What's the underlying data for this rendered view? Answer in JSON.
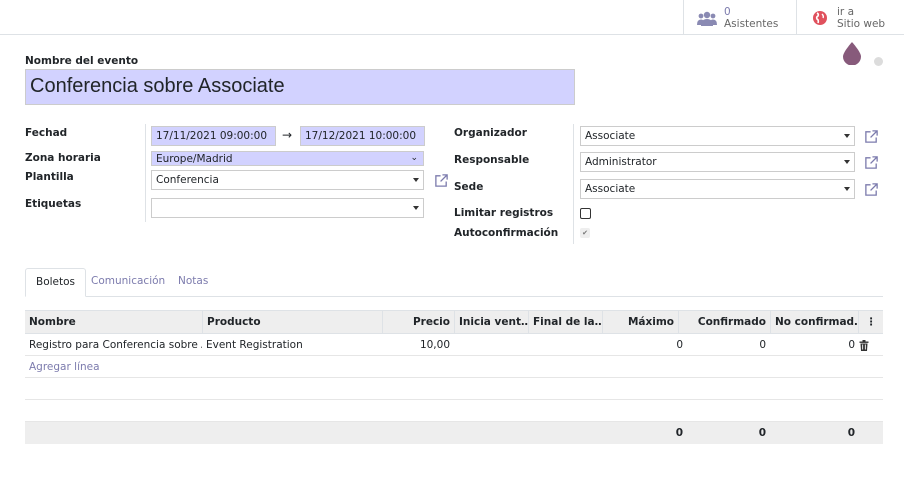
{
  "smart_buttons": {
    "attendees": {
      "count": "0",
      "label": "Asistentes"
    },
    "website": {
      "line1": "ir a",
      "line2": "Sitio web"
    }
  },
  "title_label": "Nombre del evento",
  "title_value": "Conferencia sobre Associate",
  "left_fields": {
    "date_label": "Fechad",
    "date_begin": "17/11/2021 09:00:00",
    "date_arrow": "→",
    "date_end": "17/12/2021 10:00:00",
    "tz_label": "Zona horaria",
    "tz_value": "Europe/Madrid",
    "template_label": "Plantilla",
    "template_value": "Conferencia",
    "tags_label": "Etiquetas",
    "tags_value": ""
  },
  "right_fields": {
    "organizer_label": "Organizador",
    "organizer_value": "Associate",
    "responsible_label": "Responsable",
    "responsible_value": "Administrator",
    "venue_label": "Sede",
    "venue_value": "Associate",
    "limit_label": "Limitar registros",
    "autoconfirm_label": "Autoconfirmación",
    "limit_checked": false,
    "autoconfirm_checked": true
  },
  "tabs": [
    {
      "label": "Boletos",
      "active": true
    },
    {
      "label": "Comunicación",
      "active": false
    },
    {
      "label": "Notas",
      "active": false
    }
  ],
  "table": {
    "headers": [
      "Nombre",
      "Producto",
      "Precio",
      "Inicia vent…",
      "Final de la…",
      "Máximo",
      "Confirmado",
      "No confirmad…"
    ],
    "rows": [
      {
        "name": "Registro para Conferencia sobre A…",
        "product": "Event Registration",
        "price": "10,00",
        "start": "",
        "end": "",
        "max": "0",
        "confirmed": "0",
        "unconfirmed": "0"
      }
    ],
    "add_line": "Agregar línea",
    "totals": {
      "max": "0",
      "confirmed": "0",
      "unconfirmed": "0"
    }
  },
  "colors": {
    "accent": "#7c7bad",
    "required_bg": "#d2d2ff",
    "header_bg": "#eeeeee",
    "drop_icon": "#875a7b"
  }
}
